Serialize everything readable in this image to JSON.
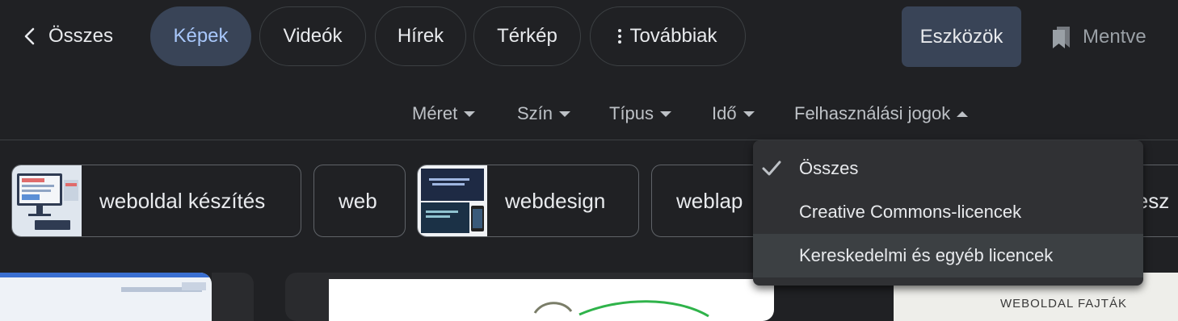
{
  "nav": {
    "back_label": "Összes",
    "tabs": [
      {
        "label": "Képek",
        "active": true
      },
      {
        "label": "Videók"
      },
      {
        "label": "Hírek"
      },
      {
        "label": "Térkép"
      },
      {
        "label": "Továbbiak"
      }
    ],
    "tools_label": "Eszközök",
    "saved_label": "Mentve",
    "icons": [
      "chevron-left-icon",
      "more-vert-icon",
      "bookmark-icon"
    ]
  },
  "filters": [
    {
      "label": "Méret",
      "caret": "down"
    },
    {
      "label": "Szín",
      "caret": "down"
    },
    {
      "label": "Típus",
      "caret": "down"
    },
    {
      "label": "Idő",
      "caret": "down"
    },
    {
      "label": "Felhasználási jogok",
      "caret": "up"
    }
  ],
  "chips": [
    {
      "label": "weboldal készítés",
      "has_thumb": true
    },
    {
      "label": "web",
      "has_thumb": false
    },
    {
      "label": "webdesign",
      "has_thumb": true
    },
    {
      "label": "weblap",
      "has_thumb": false
    },
    {
      "label": "lesz",
      "has_thumb": false
    }
  ],
  "dropdown": {
    "items": [
      {
        "label": "Összes",
        "checked": true
      },
      {
        "label": "Creative Commons-licencek"
      },
      {
        "label": "Kereskedelmi és egyéb licencek",
        "hovered": true
      }
    ]
  },
  "results": {
    "partial_caption": "WEBOLDAL FAJTÁK"
  },
  "colors": {
    "background": "#202124",
    "active_tab_bg": "#394457",
    "active_tab_text": "#a8c7fa",
    "menu_bg": "#303134",
    "border": "#3c4043"
  }
}
